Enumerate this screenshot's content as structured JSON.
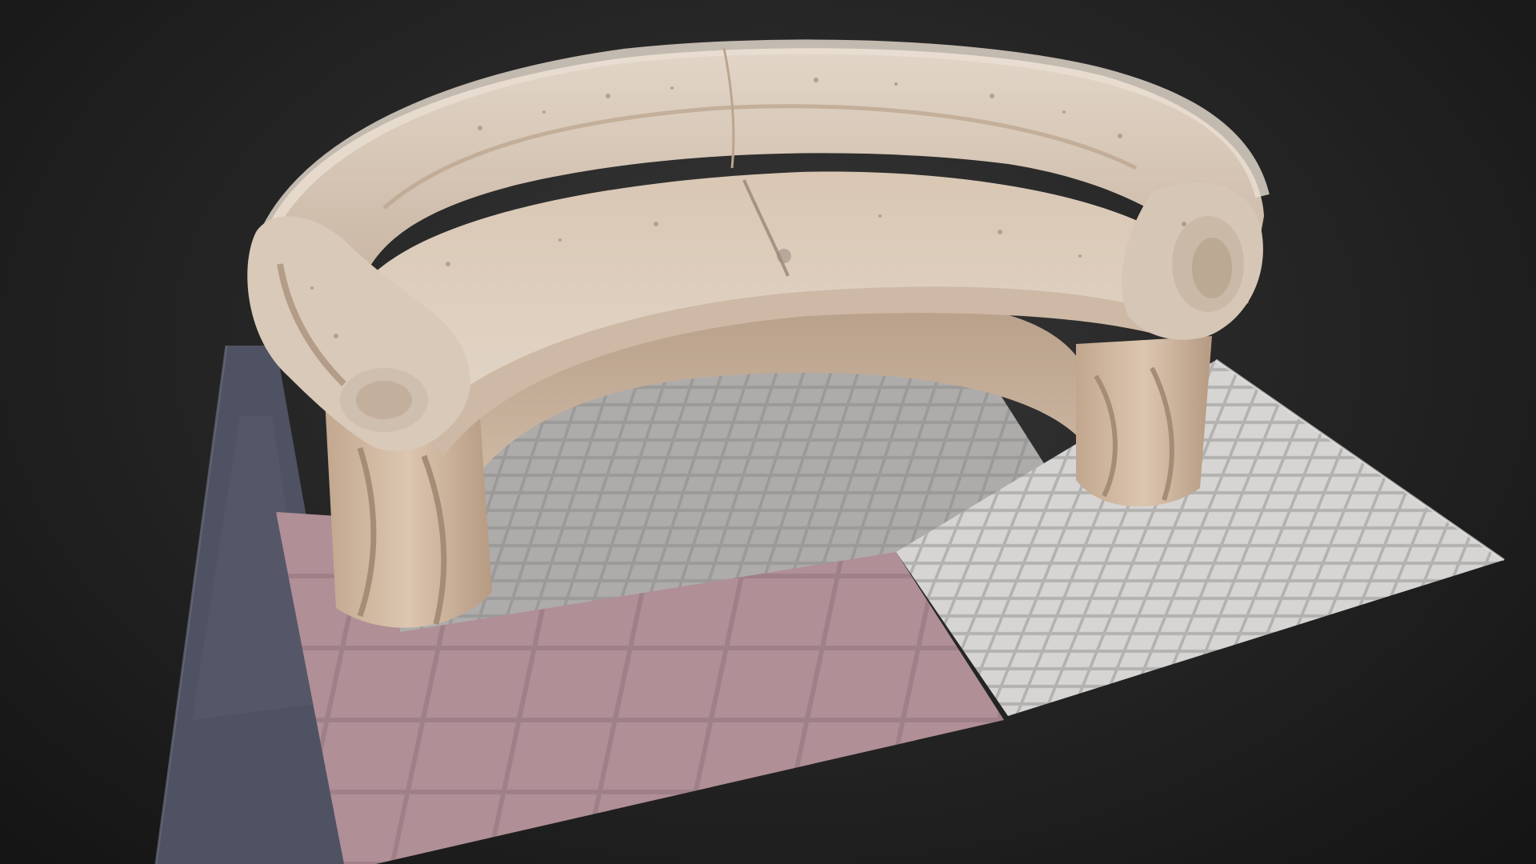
{
  "scene": {
    "subject": "stone-bench-3d-scan",
    "background_color": "#141414",
    "colors": {
      "stone_light": "#ddd0c1",
      "stone_mid": "#c9b5a2",
      "stone_shadow": "#a58e78",
      "paving_grey": "#9a9896",
      "paving_light": "#c9c8c6",
      "paving_pink": "#a8868c",
      "asphalt": "#4e5060"
    }
  }
}
